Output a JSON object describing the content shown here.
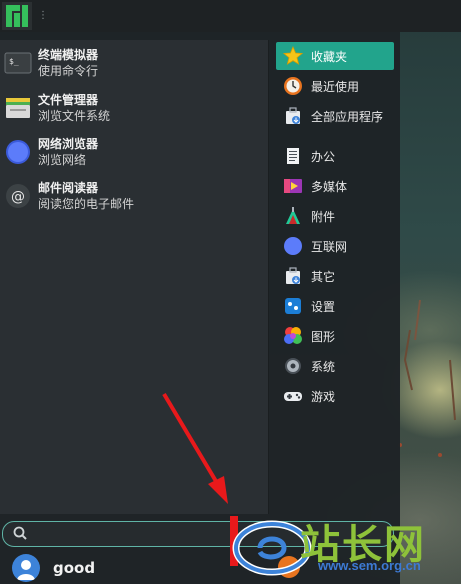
{
  "favorites": [
    {
      "name": "终端模拟器",
      "desc": "使用命令行",
      "icon": "terminal-icon"
    },
    {
      "name": "文件管理器",
      "desc": "浏览文件系统",
      "icon": "file-manager-icon"
    },
    {
      "name": "网络浏览器",
      "desc": "浏览网络",
      "icon": "web-browser-icon"
    },
    {
      "name": "邮件阅读器",
      "desc": "阅读您的电子邮件",
      "icon": "mail-icon"
    }
  ],
  "categories": [
    {
      "label": "收藏夹",
      "icon": "star-icon",
      "active": true
    },
    {
      "label": "最近使用",
      "icon": "recent-icon"
    },
    {
      "label": "全部应用程序",
      "icon": "all-apps-icon"
    },
    {
      "label": "办公",
      "icon": "office-icon"
    },
    {
      "label": "多媒体",
      "icon": "multimedia-icon"
    },
    {
      "label": "附件",
      "icon": "accessories-icon"
    },
    {
      "label": "互联网",
      "icon": "internet-icon"
    },
    {
      "label": "其它",
      "icon": "other-icon"
    },
    {
      "label": "设置",
      "icon": "settings-icon"
    },
    {
      "label": "图形",
      "icon": "graphics-icon"
    },
    {
      "label": "系统",
      "icon": "system-icon"
    },
    {
      "label": "游戏",
      "icon": "games-icon"
    }
  ],
  "search": {
    "placeholder": "",
    "value": ""
  },
  "user": {
    "name": "good"
  },
  "watermark": {
    "text": "站长网",
    "url": "www.sem.org.cn"
  },
  "colors": {
    "accent": "#22a48c",
    "panel": "#1e2224",
    "search_border": "#5fb4a6"
  }
}
